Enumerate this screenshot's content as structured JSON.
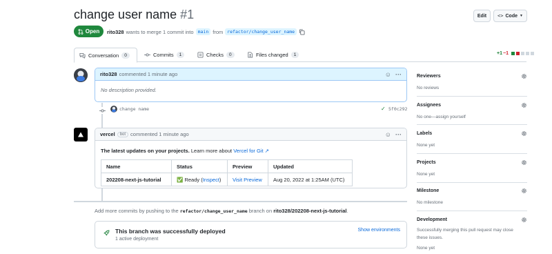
{
  "header": {
    "title": "change user name",
    "number": "#1",
    "edit_label": "Edit",
    "code_label": "Code"
  },
  "state": {
    "label": "Open",
    "author": "rito328",
    "description": "wants to merge 1 commit into",
    "base_branch": "main",
    "from_word": "from",
    "head_branch": "refactor/change_user_name"
  },
  "tabs": [
    {
      "label": "Conversation",
      "count": "0",
      "icon": "conversation-icon"
    },
    {
      "label": "Commits",
      "count": "1",
      "icon": "commit-icon"
    },
    {
      "label": "Checks",
      "count": "0",
      "icon": "checks-icon"
    },
    {
      "label": "Files changed",
      "count": "1",
      "icon": "file-diff-icon"
    }
  ],
  "diffstat": {
    "additions": "+1",
    "deletions": "−1"
  },
  "first_comment": {
    "author": "rito328",
    "action": "commented 1 minute ago",
    "body": "No description provided."
  },
  "commit": {
    "message": "change name",
    "sha": "5f0c292"
  },
  "bot_comment": {
    "author": "vercel",
    "tag": "bot",
    "action": "commented 1 minute ago",
    "intro": "The latest updates on your projects.",
    "learn_more": "Learn more about",
    "link": "Vercel for Git ↗",
    "table": {
      "headers": [
        "Name",
        "Status",
        "Preview",
        "Updated"
      ],
      "row": {
        "name": "202208-next-js-tutorial",
        "status_emoji": "✅",
        "status": "Ready",
        "inspect": "Inspect",
        "preview": "Visit Preview",
        "updated": "Aug 20, 2022 at 1:25AM (UTC)"
      }
    }
  },
  "footer": {
    "prefix": "Add more commits by pushing to the",
    "branch": "refactor/change_user_name",
    "middle": "branch on",
    "repo": "rito328/202208-next-js-tutorial",
    "suffix": "."
  },
  "deployment": {
    "title": "This branch was successfully deployed",
    "subtitle": "1 active deployment",
    "action": "Show environments"
  },
  "sidebar": [
    {
      "title": "Reviewers",
      "value": "No reviews"
    },
    {
      "title": "Assignees",
      "value": "No one—assign yourself"
    },
    {
      "title": "Labels",
      "value": "None yet"
    },
    {
      "title": "Projects",
      "value": "None yet"
    },
    {
      "title": "Milestone",
      "value": "No milestone"
    },
    {
      "title": "Development",
      "value": "Successfully merging this pull request may close these issues.",
      "value2": "None yet"
    }
  ],
  "colors": {
    "open_green": "#1f883d",
    "link_blue": "#0969da",
    "add_green": "#1a7f37",
    "del_red": "#cf222e"
  }
}
